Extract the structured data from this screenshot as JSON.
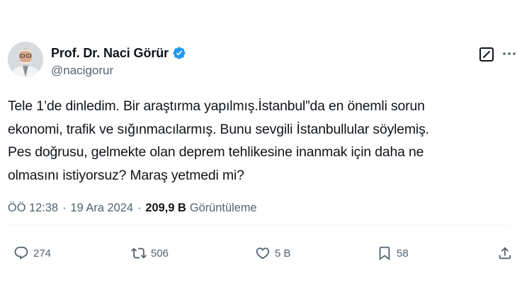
{
  "author": {
    "name": "Prof. Dr. Naci Görür",
    "handle": "@nacigorur",
    "verified_color": "#1d9bf0"
  },
  "tweet": {
    "lines": [
      "Tele 1’de dinledim. Bir araştırma yapılmış.İstanbul”da en önemli sorun",
      "ekonomi, trafik ve sığınmacılarmış. Bunu sevgili İstanbullular söylemiş.",
      "Pes doğrusu, gelmekte olan deprem tehlikesine inanmak için daha ne",
      "olmasını istiyorsuz? Maraş yetmedi mi?"
    ]
  },
  "meta": {
    "time": "ÖÖ 12:38",
    "separator": "·",
    "date": "19 Ara 2024",
    "views_count": "209,9 B",
    "views_label": "Görüntüleme"
  },
  "actions": {
    "replies": "274",
    "reposts": "506",
    "likes": "5 B",
    "bookmarks": "58"
  },
  "icons": {
    "verified": "verified-badge-icon",
    "grok": "grok-icon",
    "more": "more-icon",
    "reply": "reply-icon",
    "repost": "repost-icon",
    "like": "heart-icon",
    "bookmark": "bookmark-icon",
    "share": "share-icon"
  },
  "colors": {
    "text_primary": "#0f1419",
    "text_secondary": "#536471",
    "accent": "#1d9bf0"
  }
}
